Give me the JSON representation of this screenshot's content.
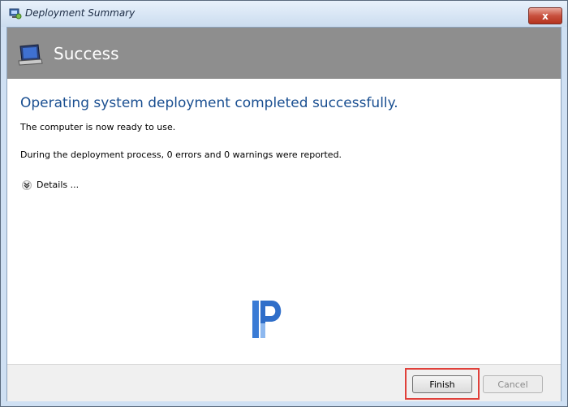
{
  "window": {
    "title": "Deployment Summary",
    "close_label": "x"
  },
  "header": {
    "title": "Success",
    "icon": "monitor-icon",
    "background": "#8e8e8e"
  },
  "content": {
    "headline": "Operating system deployment completed successfully.",
    "ready_text": "The computer is now ready to use.",
    "report_text": "During the deployment process, 0 errors and 0 warnings were reported.",
    "details_label": "Details ...",
    "headline_color": "#1a4f91"
  },
  "footer": {
    "finish_label": "Finish",
    "cancel_label": "Cancel",
    "highlight_color": "#e0403a"
  }
}
